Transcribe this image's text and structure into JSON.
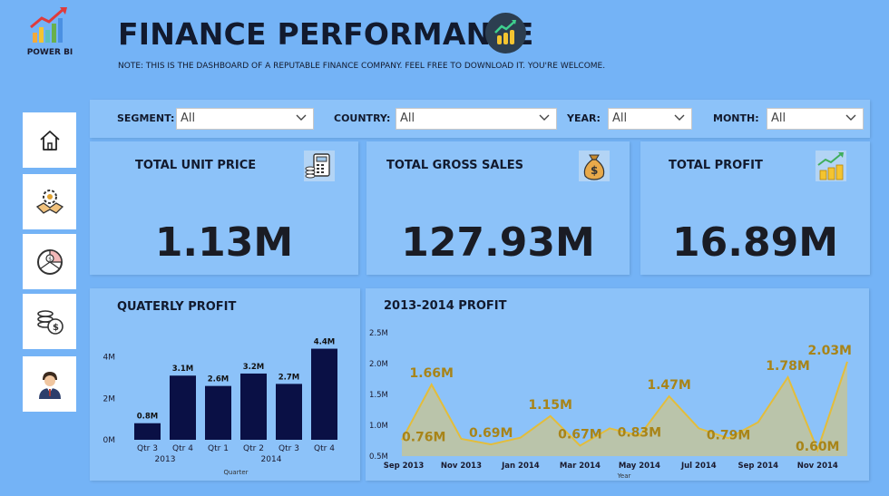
{
  "app": {
    "logo_text": "POWER BI"
  },
  "header": {
    "title": "FINANCE PERFORMANCE",
    "note": "NOTE: THIS IS THE DASHBOARD OF A REPUTABLE FINANCE COMPANY. FEEL FREE TO DOWNLOAD IT. YOU'RE WELCOME."
  },
  "nav": [
    "home-icon",
    "handshake-gear-icon",
    "money-pie-icon",
    "coins-icon",
    "person-icon"
  ],
  "filters": {
    "segment": {
      "label": "SEGMENT:",
      "value": "All"
    },
    "country": {
      "label": "COUNTRY:",
      "value": "All"
    },
    "year": {
      "label": "YEAR:",
      "value": "All"
    },
    "month": {
      "label": "MONTH:",
      "value": "All"
    }
  },
  "kpis": {
    "unit_price": {
      "title": "TOTAL UNIT PRICE",
      "value": "1.13M",
      "icon": "calculator-icon"
    },
    "gross_sales": {
      "title": "TOTAL GROSS SALES",
      "value": "127.93M",
      "icon": "money-bag-icon"
    },
    "profit": {
      "title": "TOTAL PROFIT",
      "value": "16.89M",
      "icon": "growth-coins-icon"
    }
  },
  "quarterly": {
    "title": "QUATERLY PROFIT",
    "x_label": "Quarter"
  },
  "trend": {
    "title": "2013-2014 PROFIT",
    "x_label": "Year"
  },
  "colors": {
    "background": "#74b3f6",
    "card": "#8cc2f9",
    "bar": "#0a1045",
    "line": "#e3bd3b",
    "label_gold": "#a88418"
  },
  "chart_data": [
    {
      "type": "bar",
      "categories": [
        "Qtr 3",
        "Qtr 4",
        "Qtr 1",
        "Qtr 2",
        "Qtr 3",
        "Qtr 4"
      ],
      "groups": [
        {
          "name": "2013",
          "span": [
            0,
            1
          ]
        },
        {
          "name": "2014",
          "span": [
            2,
            5
          ]
        }
      ],
      "values": [
        0.8,
        3.1,
        2.6,
        3.2,
        2.7,
        4.4
      ],
      "labels": [
        "0.8M",
        "3.1M",
        "2.6M",
        "3.2M",
        "2.7M",
        "4.4M"
      ],
      "title": "QUATERLY PROFIT",
      "xlabel": "Quarter",
      "ylabel": "",
      "yticks": [
        "0M",
        "2M",
        "4M"
      ],
      "ylim": [
        0,
        4.6
      ]
    },
    {
      "type": "area",
      "x": [
        "2013-09",
        "2013-10",
        "2013-11",
        "2013-12",
        "2014-01",
        "2014-02",
        "2014-03",
        "2014-04",
        "2014-05",
        "2014-06",
        "2014-07",
        "2014-08",
        "2014-09",
        "2014-10",
        "2014-11",
        "2014-12"
      ],
      "values": [
        0.76,
        1.66,
        0.78,
        0.69,
        0.8,
        1.15,
        0.67,
        0.95,
        0.83,
        1.47,
        0.95,
        0.79,
        1.05,
        1.78,
        0.6,
        2.03
      ],
      "labels": [
        "0.76M",
        "1.66M",
        "",
        "0.69M",
        "",
        "1.15M",
        "0.67M",
        "",
        "0.83M",
        "1.47M",
        "",
        "0.79M",
        "",
        "1.78M",
        "0.60M",
        "2.03M"
      ],
      "xticks": [
        "Sep 2013",
        "Nov 2013",
        "Jan 2014",
        "Mar 2014",
        "May 2014",
        "Jul 2014",
        "Sep 2014",
        "Nov 2014"
      ],
      "yticks": [
        "0.5M",
        "1.0M",
        "1.5M",
        "2.0M",
        "2.5M"
      ],
      "ylim": [
        0.5,
        2.5
      ],
      "title": "2013-2014 PROFIT",
      "xlabel": "Year",
      "ylabel": ""
    }
  ]
}
